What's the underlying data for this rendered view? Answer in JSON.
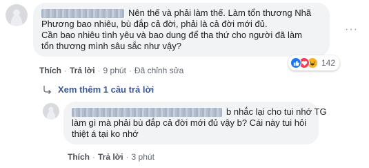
{
  "comment": {
    "text_line1": "Nên thế và phải làm thế. Làm tổn thương Nhã",
    "text_line2": "Phương bao nhiêu, bù đắp cả đời, phải là cả đời mới đủ.",
    "text_line3": "Cần bao nhiêu tình yêu và bao dung để tha thứ cho người đã làm",
    "text_line4": "tổn thương mình sâu sắc như vậy?",
    "actions": {
      "like": "Thích",
      "reply": "Trả lời",
      "time": "9 phút",
      "edited": "Đã chỉnh sửa"
    },
    "reactions": {
      "count": "142",
      "icons": [
        "like-icon",
        "love-icon",
        "haha-icon"
      ]
    },
    "options_glyph": "···"
  },
  "more_replies": {
    "label": "Xem thêm 1 câu trả lời"
  },
  "reply": {
    "text_line1": "b nhắc lại cho tui nhớ TG",
    "text_line2": "làm gì mà phải bù đắp cả đời mới đủ vậy b? Cái này tui hỏi",
    "text_line3": "thiệt á tại ko nhớ",
    "actions": {
      "like": "Thích",
      "reply": "Trả lời",
      "time": "3 phút"
    }
  },
  "colors": {
    "bubble": "#f2f3f5",
    "link": "#385898",
    "like": "#1877f2",
    "love": "#f33e58",
    "haha": "#f7b125"
  }
}
